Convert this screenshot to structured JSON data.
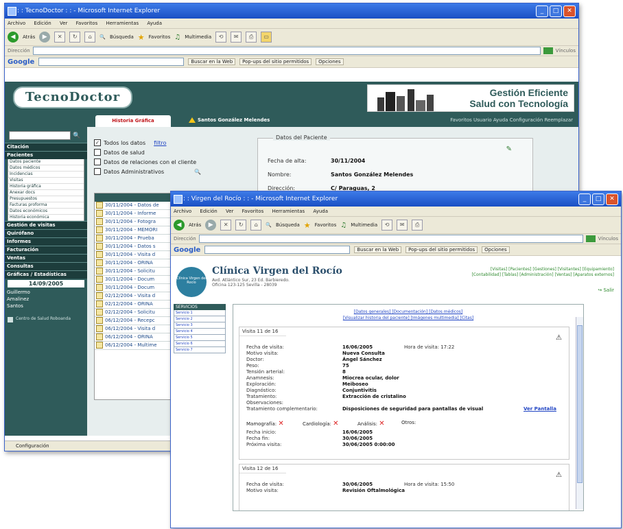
{
  "window1": {
    "title": ": : TecnoDoctor : : - Microsoft Internet Explorer",
    "menu": [
      "Archivo",
      "Edición",
      "Ver",
      "Favoritos",
      "Herramientas",
      "Ayuda"
    ],
    "toolbar": {
      "back": "Atrás",
      "search": "Búsqueda",
      "favorites": "Favoritos",
      "multimedia": "Multimedia"
    },
    "address_label": "Dirección",
    "links_label": "Vínculos",
    "google": {
      "logo": "Google",
      "search_web": "Buscar en la Web",
      "popups": "Pop-ups del sitio permitidos",
      "options": "Opciones"
    },
    "logo_text": "TecnoDoctor",
    "slogan_line1": "Gestión Eficiente",
    "slogan_line2": "Salud con Tecnología",
    "tabs": {
      "active": "Historia Gráfica",
      "patient": "Santos González Melendes"
    },
    "top_links": "Favoritos  Usuario  Ayuda  Configuración  Reemplazar",
    "sidebar": {
      "sections": [
        "Citación",
        "Pacientes"
      ],
      "patient_items": [
        "Datos paciente",
        "Datos médicos",
        "Incidencias",
        "Visitas",
        "Historia gráfica",
        "Anexar docs",
        "Presupuestos",
        "Facturas proforma",
        "Datos económicos",
        "Historia económica"
      ],
      "more_sections": [
        "Gestión de visitas",
        "Quirófano",
        "Informes",
        "Facturación",
        "Ventas",
        "Consultas",
        "Gráficas / Estadísticas"
      ],
      "date": "14/09/2005",
      "users": [
        "Guillermo",
        "Amalinez",
        "Santos"
      ],
      "footer": "Centro de Salud Roboanda"
    },
    "checkboxes": {
      "all": "Todos los datos",
      "filter": "filtro",
      "health": "Datos de salud",
      "relations": "Datos de relaciones con el cliente",
      "admin": "Datos Administrativos"
    },
    "history_rows": [
      "30/11/2004 - Datos de",
      "30/11/2004 - Informe",
      "30/11/2004 - Fotogra",
      "30/11/2004 - MEMORI",
      "30/11/2004 - Prueba",
      "30/11/2004 - Datos s",
      "30/11/2004 - Visita d",
      "30/11/2004 - ORINA",
      "30/11/2004 - Solicitu",
      "30/11/2004 - Docum",
      "30/11/2004 - Docum",
      "02/12/2004 - Visita d",
      "02/12/2004 - ORINA",
      "02/12/2004 - Solicitu",
      "06/12/2004 - Recepc",
      "06/12/2004 - Visita d",
      "06/12/2004 - ORINA",
      "06/12/2004 - Multime"
    ],
    "patient": {
      "legend": "Datos del Paciente",
      "fields": [
        {
          "label": "Fecha de alta:",
          "value": "30/11/2004"
        },
        {
          "label": "Nombre:",
          "value": "Santos González Melendes"
        },
        {
          "label": "Dirección:",
          "value": "C/ Paraguas, 2"
        }
      ]
    },
    "status": "Configuración"
  },
  "window2": {
    "title": ": : Virgen del Rocío : : - Microsoft Internet Explorer",
    "menu": [
      "Archivo",
      "Edición",
      "Ver",
      "Favoritos",
      "Herramientas",
      "Ayuda"
    ],
    "toolbar": {
      "back": "Atrás",
      "search": "Búsqueda",
      "favorites": "Favoritos",
      "multimedia": "Multimedia"
    },
    "address_label": "Dirección",
    "links_label": "Vínculos",
    "google": {
      "logo": "Google",
      "search_web": "Buscar en la Web",
      "popups": "Pop-ups del sitio permitidos",
      "options": "Opciones"
    },
    "clinic_logo": "Clínica Virgen del Rocío",
    "clinic_name": "Clínica Virgen del Rocío",
    "clinic_address": "Avd. Atlántico Sur, 23  Ed. Barbieredo. Oficina 123-125  Sevilla - 28039",
    "top_links_1": "[Visitas] [Pacientes] [Gestiones] [Visitantes] [Equipamiento]",
    "top_links_2": "[Contabilidad] [Tablas] [Administración] [Ventas] [Aparatos externos]",
    "logout": "Salir",
    "side_title": "SERVICIOS",
    "side_items": [
      "Servicio 1",
      "Servicio 2",
      "Servicio 3",
      "Servicio 4",
      "Servicio 5",
      "Servicio 6",
      "Servicio 7"
    ],
    "nav_1": "[Datos generales]  [Documentación]  [Datos médicos]",
    "nav_2": "[Visualizar historia del paciente]  [Imágenes multimedia]  [Citas]",
    "visit1": {
      "title": "Visita 11 de 16",
      "rows": [
        {
          "label": "Fecha de visita:",
          "value": "16/06/2005",
          "extra": "Hora de visita:  17:22"
        },
        {
          "label": "Motivo visita:",
          "value": "Nueva Consulta"
        },
        {
          "label": "Doctor:",
          "value": "Ángel Sánchez"
        },
        {
          "label": "Peso:",
          "value": "75"
        },
        {
          "label": "Tensión arterial:",
          "value": "8"
        },
        {
          "label": "Anamnesis:",
          "value": "Miocrea ocular, dolor"
        },
        {
          "label": "Exploración:",
          "value": "Meiboseo"
        },
        {
          "label": "Diagnóstico:",
          "value": "Conjuntivitis"
        },
        {
          "label": "Tratamiento:",
          "value": "Extracción de cristalino"
        },
        {
          "label": "Observaciones:",
          "value": ""
        },
        {
          "label": "Tratamiento complementario:",
          "value": "Disposiciones de seguridad para pantallas de visual",
          "link": "Ver Pantalla"
        }
      ],
      "tests": {
        "mamografia": "Mamografía:",
        "cardiologia": "Cardiología:",
        "analisis": "Análisis:",
        "otros": "Otros:"
      },
      "dates": [
        {
          "label": "Fecha inicio:",
          "value": "16/06/2005"
        },
        {
          "label": "Fecha fin:",
          "value": "30/06/2005"
        },
        {
          "label": "Próxima visita:",
          "value": "30/06/2005 0:00:00"
        }
      ]
    },
    "visit2": {
      "title": "Visita 12 de 16",
      "rows": [
        {
          "label": "Fecha de visita:",
          "value": "30/06/2005",
          "extra": "Hora de visita:  15:50"
        },
        {
          "label": "Motivo visita:",
          "value": "Revisión Oftalmológica"
        }
      ]
    }
  }
}
